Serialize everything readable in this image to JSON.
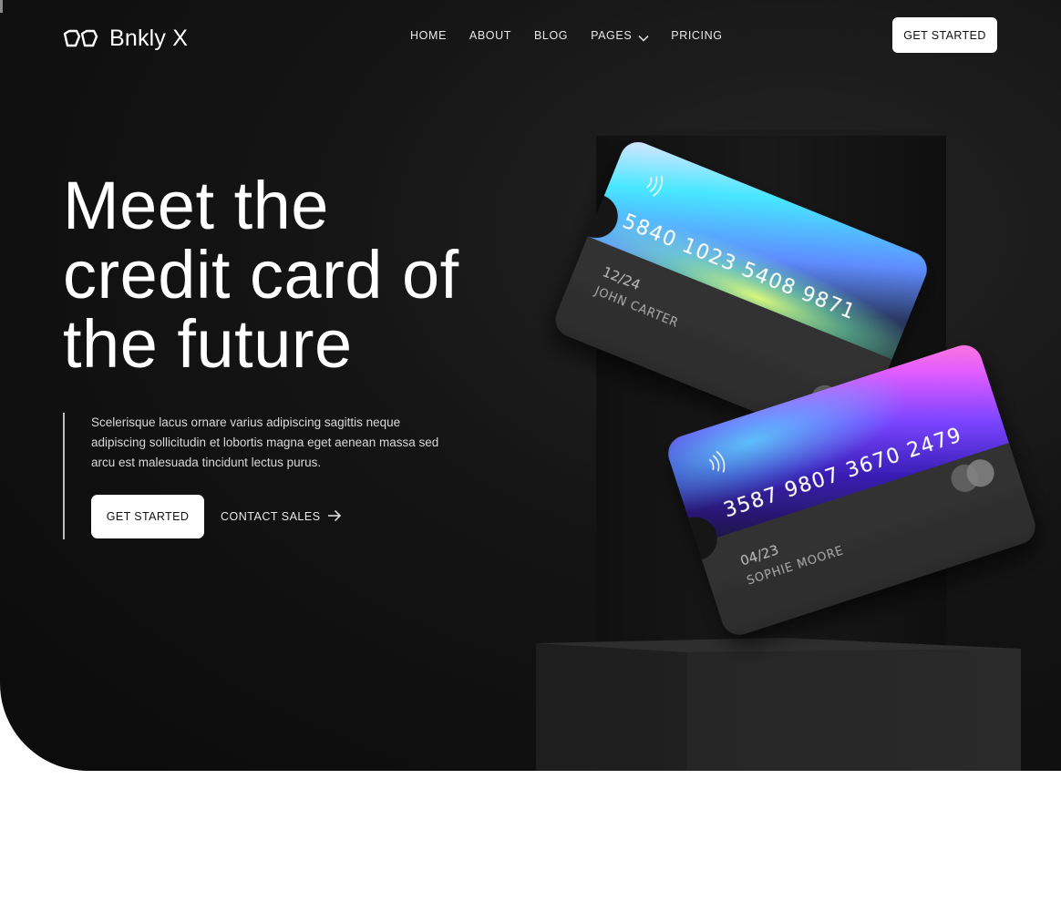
{
  "brand": {
    "name": "Bnkly X",
    "logo_icon": "logo-icon"
  },
  "nav": {
    "items": [
      {
        "label": "HOME"
      },
      {
        "label": "ABOUT"
      },
      {
        "label": "BLOG"
      },
      {
        "label": "PAGES",
        "has_dropdown": true,
        "icon": "chevron-down-icon"
      },
      {
        "label": "PRICING"
      }
    ],
    "cta_label": "GET STARTED"
  },
  "hero": {
    "headline": "Meet the credit card of the future",
    "description": "Scelerisque lacus ornare varius adipiscing sagittis neque adipiscing sollicitudin et lobortis magna eget aenean massa sed arcu est malesuada tincidunt lectus purus.",
    "primary_cta": "GET STARTED",
    "secondary_cta": "CONTACT SALES",
    "secondary_icon": "arrow-right-icon"
  },
  "cards": [
    {
      "number": "5840 1023 5408 9871",
      "expiry": "12/24",
      "holder": "JOHN CARTER"
    },
    {
      "number": "3587 9807 3670 2479",
      "expiry": "04/23",
      "holder": "SOPHIE MOORE"
    }
  ],
  "colors": {
    "background": "#0b0b0b",
    "text": "#ffffff",
    "button_bg": "#ffffff",
    "button_text": "#111111"
  }
}
